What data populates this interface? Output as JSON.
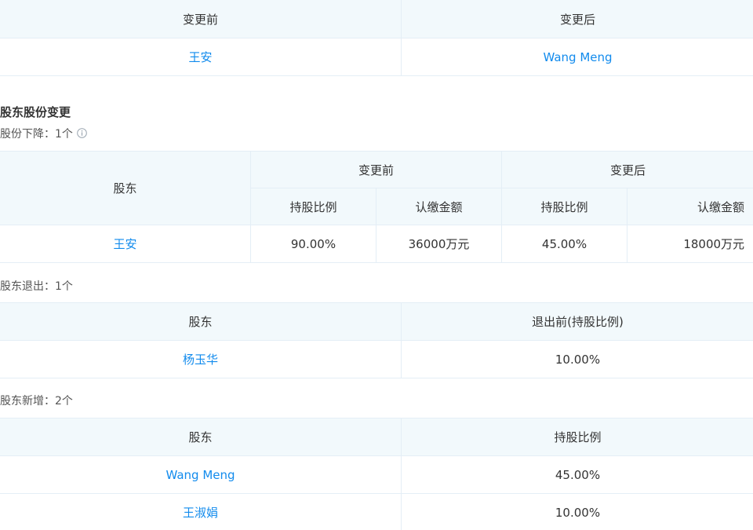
{
  "name_change": {
    "headers": [
      "变更前",
      "变更后"
    ],
    "before": "王安",
    "after": "Wang Meng"
  },
  "equity_change": {
    "title": "股东股份变更",
    "decrease": {
      "label": "股份下降：1个",
      "info_icon": "info-circle-icon",
      "header_shareholder": "股东",
      "header_before": "变更前",
      "header_after": "变更后",
      "sub_headers": [
        "持股比例",
        "认缴金额",
        "持股比例",
        "认缴金额"
      ],
      "rows": [
        {
          "shareholder": "王安",
          "before_ratio": "90.00%",
          "before_amount": "36000万元",
          "after_ratio": "45.00%",
          "after_amount": "18000万元"
        }
      ]
    },
    "exit": {
      "label": "股东退出：1个",
      "headers": [
        "股东",
        "退出前(持股比例)"
      ],
      "rows": [
        {
          "shareholder": "杨玉华",
          "ratio": "10.00%"
        }
      ]
    },
    "added": {
      "label": "股东新增：2个",
      "headers": [
        "股东",
        "持股比例"
      ],
      "rows": [
        {
          "shareholder": "Wang Meng",
          "ratio": "45.00%"
        },
        {
          "shareholder": "王淑娟",
          "ratio": "10.00%"
        }
      ]
    }
  },
  "colors": {
    "link": "#128bed",
    "header_bg": "#f2f9fc",
    "border": "#e4eef6",
    "text": "#333333"
  }
}
